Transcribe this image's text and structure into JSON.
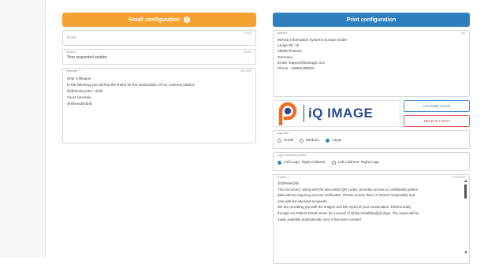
{
  "email_config": {
    "header": "Email configuration",
    "from": {
      "placeholder": "From",
      "counter": "0/120"
    },
    "subject": {
      "label": "Subject",
      "value": "Your requested studies",
      "counter": "22/100"
    },
    "message": {
      "label": "Message ⓘ",
      "counter": "147/2400",
      "lines": [
        "Dear colleague",
        "",
        "In the following you will find the link(s) for the examination of our common patient:",
        "",
        "@@StudyLinks~~@@",
        "",
        "Yours sincerely",
        "@@sender@@"
      ]
    }
  },
  "print_config": {
    "header": "Print configuration",
    "address": {
      "label": "Address",
      "counter": "6/6",
      "lines": [
        "IMAGE Information Systems Europe GmbH",
        "Lange Str. 1b",
        "18055 Rostock",
        "Germany",
        "Email: support@iqimage.com",
        "Phone: +49381496820"
      ]
    },
    "logo": {
      "text": "iQ IMAGE",
      "brand_orange": "#f26b21",
      "brand_blue": "#2b4a8c"
    },
    "buttons": {
      "change_logo": "CHANGE LOGO",
      "delete_logo": "DELETE LOGO"
    },
    "logo_size": {
      "label": "Logo size",
      "options": [
        "Small",
        "Medium",
        "Large"
      ],
      "selected": "Large"
    },
    "logo_position": {
      "label": "Logo & Address position",
      "options": [
        "Left Logo, Right Address",
        "Left Address, Right Logo"
      ],
      "selected": "Left Logo, Right Address"
    },
    "content": {
      "label": "Content ⓘ",
      "counter": "1023/4000",
      "lines": [
        "@@Date@@",
        "",
        "This document, along with the associated QR codes, provides access to confidential patient",
        "data without requiring account verification. Please ensure that it is shared responsibly and",
        "only with the intended recipients.",
        "",
        "We are providing you with the images and the report of your examination. Electronically",
        "through our Patient Portal server for a period of @@LinkValidity@@ days. The report will be",
        "made available automatically once it has been created."
      ]
    }
  },
  "colors": {
    "orange": "#f5a230",
    "blue": "#2f7fbe",
    "delete_red": "#d43d3d"
  }
}
